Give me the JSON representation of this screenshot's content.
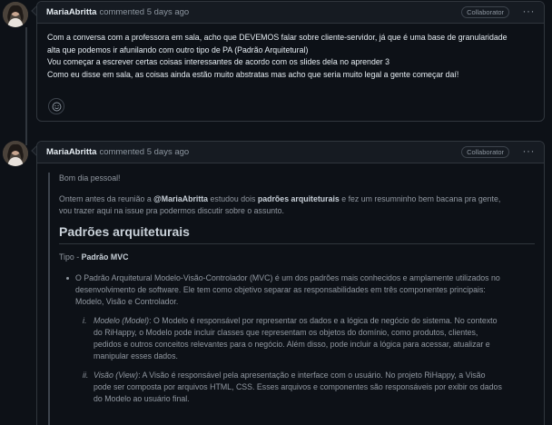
{
  "comment1": {
    "author": "MariaAbritta",
    "meta": "commented 5 days ago",
    "badge": "Collaborator",
    "menu": "···",
    "lines": [
      "Com a conversa com a professora em sala, acho que DEVEMOS falar sobre cliente-servidor, já que é uma base de granularidade",
      "alta que podemos ir afunilando com outro tipo de PA (Padrão Arquitetural)",
      "Vou começar a escrever certas coisas interessantes de acordo com os slides dela no aprender 3",
      "Como eu disse em sala, as coisas ainda estão muito abstratas mas acho que seria muito legal a gente começar daí!"
    ],
    "reaction_icon": "smiley-icon"
  },
  "comment2": {
    "author": "MariaAbritta",
    "meta": "commented 5 days ago",
    "badge": "Collaborator",
    "menu": "···",
    "greeting": "Bom dia pessoal!",
    "intro_pre": "Ontem antes da reunião a ",
    "intro_mention": "@MariaAbritta",
    "intro_mid": " estudou dois ",
    "intro_strong": "padrões arquiteturais",
    "intro_post": " e fez um resumninho bem bacana pra gente,",
    "intro_line2": "vou trazer aqui na issue pra podermos discutir sobre o assunto.",
    "heading": "Padrões arquiteturais",
    "type_label": "Tipo - ",
    "type_value": "Padrão MVC",
    "bullet_lines": [
      "O Padrão Arquitetural Modelo-Visão-Controlador (MVC) é um dos padrões mais conhecidos e amplamente utilizados no",
      "desenvolvimento de software. Ele tem como objetivo separar as responsabilidades em três componentes principais:",
      "Modelo, Visão e Controlador."
    ],
    "sub1_num": "i.",
    "sub1_term": "Modelo (Model)",
    "sub1_lines": [
      ": O Modelo é responsável por representar os dados e a lógica de negócio do sistema. No contexto",
      "do RiHappy, o Modelo pode incluir classes que representam os objetos do domínio, como produtos, clientes,",
      "pedidos e outros conceitos relevantes para o negócio. Além disso, pode incluir a lógica para acessar, atualizar e",
      "manipular esses dados."
    ],
    "sub2_num": "ii.",
    "sub2_term": "Visão (View)",
    "sub2_lines": [
      ": A Visão é responsável pela apresentação e interface com o usuário. No projeto RiHappy, a Visão",
      "pode ser composta por arquivos HTML, CSS. Esses arquivos e componentes são responsáveis por exibir os dados",
      "do Modelo ao usuário final."
    ]
  }
}
